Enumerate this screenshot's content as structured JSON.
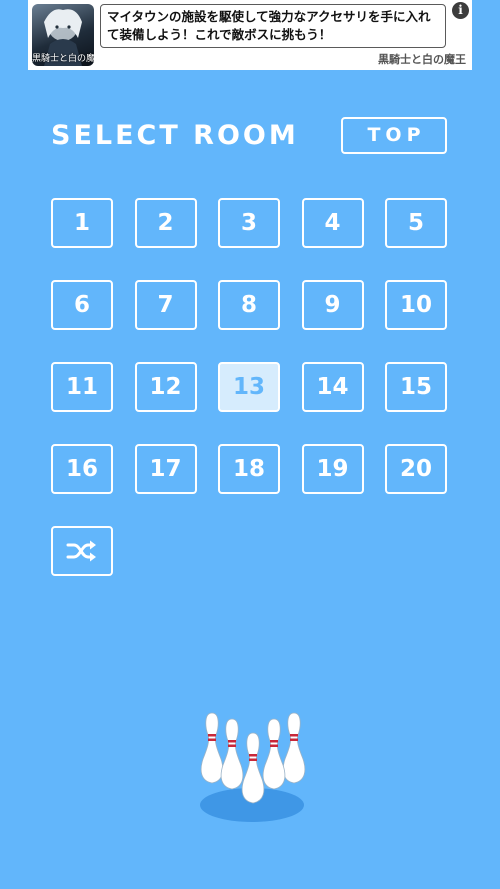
{
  "ad": {
    "thumb_label": "黒騎士と白の魔王",
    "text": "マイタウンの施設を駆使して強力なアクセサリを手に入れて装備しよう！これで敵ボスに挑もう！",
    "source": "黒騎士と白の魔王",
    "info_glyph": "i"
  },
  "header": {
    "title": "SELECT ROOM",
    "top_label": "TOP"
  },
  "rooms": {
    "items": [
      "1",
      "2",
      "3",
      "4",
      "5",
      "6",
      "7",
      "8",
      "9",
      "10",
      "11",
      "12",
      "13",
      "14",
      "15",
      "16",
      "17",
      "18",
      "19",
      "20"
    ],
    "current": "13",
    "shuffle_icon": "shuffle-icon"
  },
  "decor": {
    "pins_icon": "bowling-pins-icon"
  },
  "colors": {
    "background": "#62b6fb",
    "selected_fill": "#d6ecfd",
    "pin_stripe": "#c8283a"
  }
}
